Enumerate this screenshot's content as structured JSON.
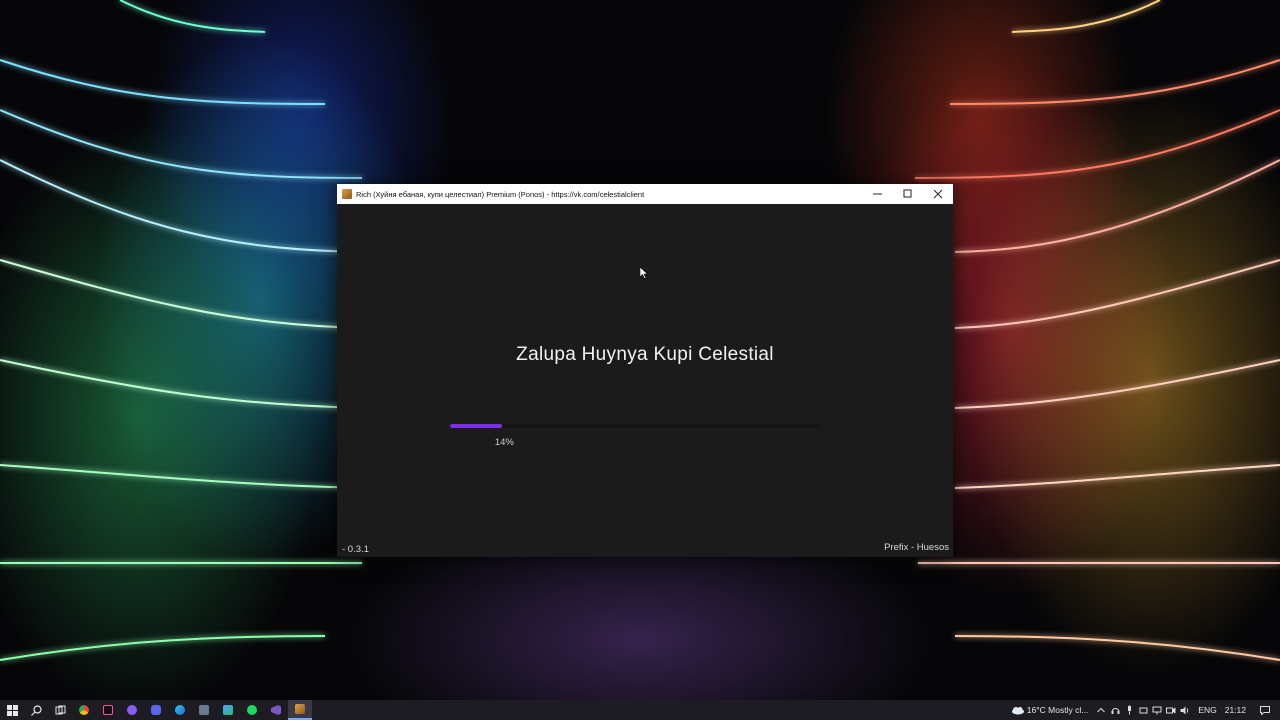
{
  "window": {
    "title": "Rich (Хуйня ебаная, купи целестиал) Premium (Ponos) - https://vk.com/celestialclient",
    "minimize_symbol": "–",
    "maximize_symbol": "☐",
    "close_symbol": "✕"
  },
  "loader": {
    "title": "Zalupa Huynya Kupi Celestial",
    "progress_percent": 14,
    "progress_label": "14%",
    "accent_color": "#7d2cf0",
    "version": "- 0.3.1",
    "credit": "Prefix - Huesos"
  },
  "taskbar": {
    "apps": [
      {
        "icon": "windows-start-icon"
      },
      {
        "icon": "search-icon"
      },
      {
        "icon": "task-view-icon"
      },
      {
        "icon": "chrome-icon"
      },
      {
        "icon": "intellij-icon"
      },
      {
        "icon": "github-desktop-icon"
      },
      {
        "icon": "discord-icon"
      },
      {
        "icon": "edge-icon"
      },
      {
        "icon": "tool-icon"
      },
      {
        "icon": "installer-icon"
      },
      {
        "icon": "spotify-icon"
      },
      {
        "icon": "visual-studio-icon"
      },
      {
        "icon": "rich-client-icon",
        "active": true
      }
    ],
    "weather": "16°C  Mostly cl...",
    "language": "ENG",
    "time": "21:12"
  }
}
